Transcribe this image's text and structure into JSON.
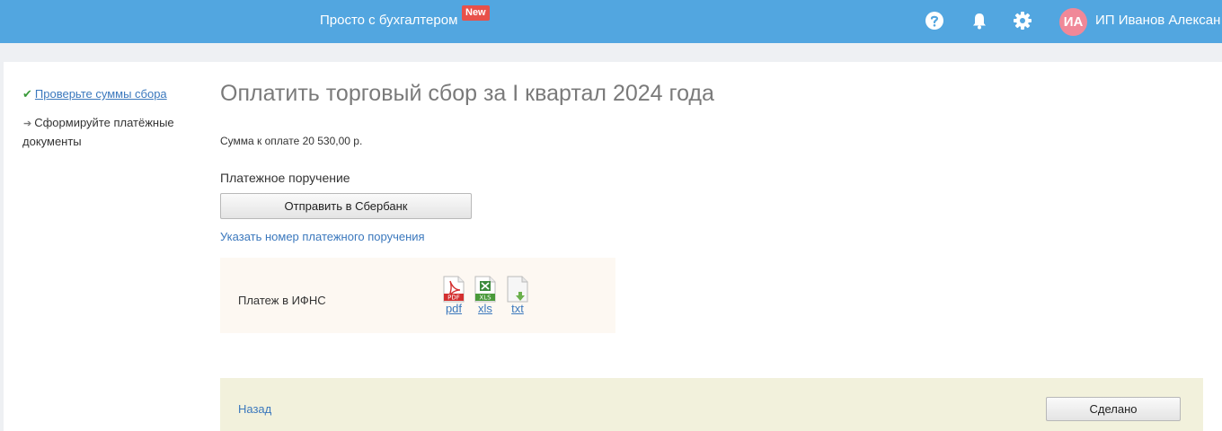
{
  "header": {
    "brand": "Просто с бухгалтером",
    "badge": "New",
    "avatar_initials": "ИА",
    "user_name": "ИП Иванов Алексан",
    "icons": [
      "help-icon",
      "bell-icon",
      "gear-icon"
    ],
    "colors": {
      "bar": "#52a6e0",
      "badge": "#e8514a",
      "avatar": "#f08898"
    }
  },
  "steps": [
    {
      "label": "Проверьте суммы сбора",
      "status": "done",
      "icon": "check-icon"
    },
    {
      "label": "Сформируйте платёжные документы",
      "status": "current",
      "icon": "arrow-right-icon"
    }
  ],
  "main": {
    "title": "Оплатить торговый сбор за I квартал 2024 года",
    "amount_text": "Сумма к оплате 20 530,00 р.",
    "payment_order_label": "Платежное поручение",
    "send_button": "Отправить в Сбербанк",
    "specify_number_link": "Указать номер платежного поручения",
    "payment_box": {
      "label": "Платеж в ИФНС",
      "files": [
        {
          "format": "pdf",
          "icon": "pdf-file-icon",
          "icon_text": "PDF"
        },
        {
          "format": "xls",
          "icon": "xls-file-icon",
          "icon_text": "XLS"
        },
        {
          "format": "txt",
          "icon": "txt-file-icon"
        }
      ]
    }
  },
  "footer": {
    "back_link": "Назад",
    "done_button": "Сделано"
  }
}
